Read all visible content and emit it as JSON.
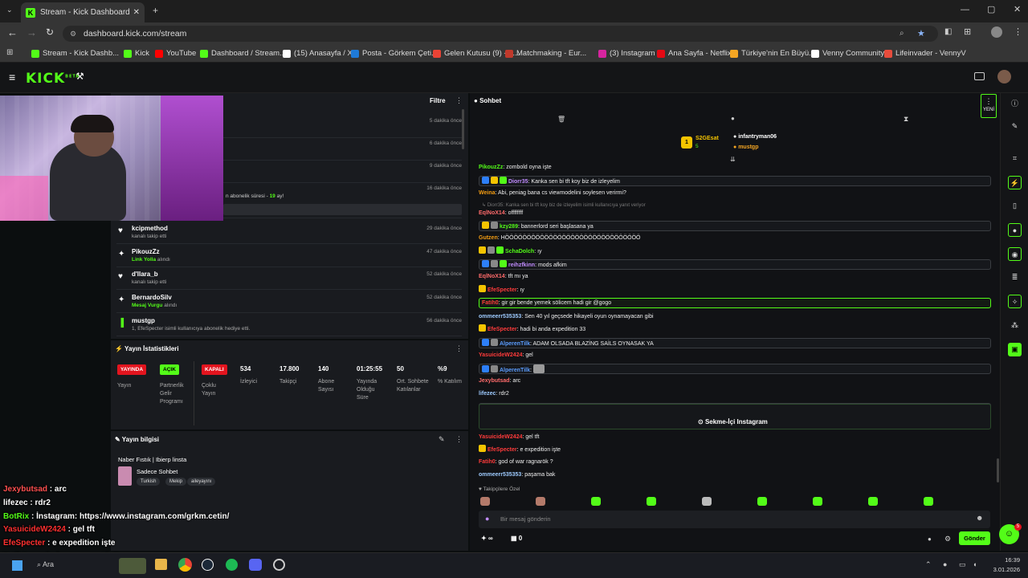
{
  "browser": {
    "tab_title": "Stream - Kick Dashboard",
    "url": "dashboard.kick.com/stream",
    "bookmarks": [
      {
        "label": "Stream - Kick Dashb...",
        "color": "#53fc18"
      },
      {
        "label": "Kick",
        "color": "#53fc18"
      },
      {
        "label": "YouTube",
        "color": "#ff0000"
      },
      {
        "label": "Dashboard / Stream...",
        "color": "#53fc18"
      },
      {
        "label": "(15) Anasayfa / X",
        "color": "#ffffff"
      },
      {
        "label": "Posta - Görkem Çeti...",
        "color": "#1e7ad8"
      },
      {
        "label": "Gelen Kutusu (9) - g...",
        "color": "#ea4335"
      },
      {
        "label": "Matchmaking - Eur...",
        "color": "#c0392b"
      },
      {
        "label": "(3) Instagram",
        "color": "#d6249f"
      },
      {
        "label": "Ana Sayfa - Netflix",
        "color": "#e50914"
      },
      {
        "label": "Türkiye'nin En Büyü...",
        "color": "#f5a623"
      },
      {
        "label": "Venny Community",
        "color": "#ffffff"
      },
      {
        "label": "Lifeinvader - VennyV",
        "color": "#e74c3c"
      }
    ]
  },
  "kick": {
    "logo": "KICK",
    "logo_tag": "BETA"
  },
  "activity": {
    "filter_label": "Filtre",
    "partial_times": [
      "5 dakika önce",
      "6 dakika önce",
      "9 dakika önce",
      "16 dakika önce"
    ],
    "partial_sub_text": "n abonelik süresi - ",
    "partial_sub_months": "19",
    "partial_sub_suffix": " ay!",
    "events": [
      {
        "name": "kcipmethod",
        "sub": "kanalı takip etti",
        "time": "29 dakika önce",
        "icon": "♥"
      },
      {
        "name": "PikouzZz",
        "sub_hl": "Link Yolla",
        "sub": " alındı",
        "time": "47 dakika önce",
        "icon": "✦"
      },
      {
        "name": "d'llara_b",
        "sub": "kanalı takip etti",
        "time": "52 dakika önce",
        "icon": "♥"
      },
      {
        "name": "BernardoSilv",
        "sub_hl": "Mesaj Vurgu",
        "sub": " alındı",
        "time": "52 dakika önce",
        "icon": "✦"
      },
      {
        "name": "mustgp",
        "sub": "1, EfeSpecter isimli kullanıcıya abonelik hediye etti.",
        "time": "56 dakika önce",
        "icon": "▐"
      }
    ]
  },
  "stats": {
    "title": "Yayın İstatistikleri",
    "status": {
      "badge": "YAYINDA",
      "label": "Yayın"
    },
    "partner": {
      "badge": "AÇIK",
      "label": "Partnerlik Gelir Programı"
    },
    "multi": {
      "badge": "KAPALI",
      "label": "Çoklu Yayın"
    },
    "metrics": [
      {
        "value": "534",
        "label": "İzleyici"
      },
      {
        "value": "17.800",
        "label": "Takipçi"
      },
      {
        "value": "140",
        "label": "Abone Sayısı"
      },
      {
        "value": "01:25:55",
        "label": "Yayında Olduğu Süre"
      },
      {
        "value": "50",
        "label": "Ort. Sohbete Katılanlar"
      },
      {
        "value": "%9",
        "label": "% Katılım"
      }
    ]
  },
  "info": {
    "title": "Yayın bilgisi",
    "stream_title": "Naber Fıstık | Ibierp linsta",
    "category": "Sadece Sohbet",
    "tags": [
      "Turkish",
      "Mekip",
      "aileyayını"
    ]
  },
  "chat": {
    "title": "Sohbet",
    "new_label": "YENİ",
    "top": {
      "user1": "S2GEsat",
      "user1_count": "5",
      "user2": "infantryman06",
      "user3": "mustgp"
    },
    "messages": [
      {
        "u": "PikouzZz",
        "c": "#53fc18",
        "t": "zombold oyna işte"
      },
      {
        "u": "Diorr35",
        "c": "#c18cff",
        "t": "Kanka sen bi tft koy biz de izleyelim",
        "hl": true,
        "icons": [
          "#2d7ff9",
          "#f5c400",
          "#53fc18"
        ]
      },
      {
        "u": "Weina",
        "c": "#f39c12",
        "t": "Abi, peniag bana cs viewmodelini soylesen verirmi?"
      },
      {
        "reply": "↳ Diorr35: Kanka sen bi tft koy biz de izleyelim isimli kullanıcıya yanıt veriyor"
      },
      {
        "u": "EqlNoX14",
        "c": "#ff6b6b",
        "t": "offffffff"
      },
      {
        "u": "kzy289",
        "c": "#53fc18",
        "t": "bannerlord seri başlasana ya",
        "hl": true,
        "icons": [
          "#f5c400",
          "#888"
        ]
      },
      {
        "u": "Gutzen",
        "c": "#f39c12",
        "t": "HÖÖÖÖÖÖÖÖÖÖÖÖÖÖÖÖÖÖÖÖÖÖÖÖÖÖÖÖÖÖÖ"
      },
      {
        "u": "SchaDolch",
        "c": "#53fc18",
        "t": "ıy",
        "icons": [
          "#f5c400",
          "#888",
          "#53fc18"
        ]
      },
      {
        "u": "reihzfkinn",
        "c": "#c18cff",
        "t": "mods afkim",
        "hl": true,
        "icons": [
          "#2d7ff9",
          "#888",
          "#53fc18"
        ]
      },
      {
        "u": "EqlNoX14",
        "c": "#ff6b6b",
        "t": "tft mı ya"
      },
      {
        "u": "EfeSpecter",
        "c": "#ff3b3b",
        "t": "ıy",
        "icons": [
          "#f5c400"
        ]
      },
      {
        "u": "Fatih0",
        "c": "#ff3b3b",
        "t": "gir gir bende yemek sölicem hadi gir @gogo",
        "green": true
      },
      {
        "u": "ommeerr535353",
        "c": "#9ecbff",
        "t": "Sen 40 yıl geçsede hikayeli oyun oynamayacan gibi"
      },
      {
        "u": "EfeSpecter",
        "c": "#ff3b3b",
        "t": "hadi bi anda expedition 33",
        "icons": [
          "#f5c400"
        ]
      },
      {
        "u": "AlperenTilk",
        "c": "#5b9dff",
        "t": "ADAM OLSADA BLAZİNG SAİLS OYNASAK YA",
        "hl": true,
        "icons": [
          "#2d7ff9",
          "#888"
        ]
      },
      {
        "u": "YasuicideW2424",
        "c": "#ff3b3b",
        "t": "gel"
      },
      {
        "u": "AlperenTilk",
        "c": "#5b9dff",
        "t": "",
        "hl": true,
        "icons": [
          "#2d7ff9",
          "#888"
        ],
        "emote": true
      },
      {
        "u": "Jexybutsad",
        "c": "#ff6b6b",
        "t": "arc"
      },
      {
        "u": "lifezec",
        "c": "#9ecbff",
        "t": "rdr2"
      },
      {
        "u": "BotRix",
        "c": "#53fc18",
        "t": "İnstagram: ",
        "link": "https://www.instagram.com/grkm.cetin/",
        "hl": true,
        "icons": [
          "#2d7ff9",
          "#53fc18"
        ]
      },
      {
        "u": "YasuicideW2424",
        "c": "#ff3b3b",
        "t": "gel tft"
      },
      {
        "u": "EfeSpecter",
        "c": "#ff3b3b",
        "t": "e expedition işte",
        "icons": [
          "#f5c400"
        ]
      },
      {
        "u": "Fatih0",
        "c": "#ff3b3b",
        "t": "god of war ragnarök ?"
      },
      {
        "u": "ommeerr535353",
        "c": "#9ecbff",
        "t": "paşama bak"
      }
    ],
    "insta_button": "Sekme-İçi Instagram",
    "special_label": "Takipçilere Özel",
    "input_placeholder": "Bir mesaj gönderin",
    "send_label": "Gönder",
    "points": "∞",
    "counter": "0"
  },
  "overlay": {
    "chat": [
      {
        "u": "Jexybutsad",
        "c": "#ff5050",
        "t": "arc"
      },
      {
        "u": "lifezec",
        "c": "#ffffff",
        "t": "rdr2"
      },
      {
        "u": "BotRix",
        "c": "#53fc18",
        "t": "İnstagram: https://www.instagram.com/grkm.cetin/"
      },
      {
        "u": "YasuicideW2424",
        "c": "#ff3030",
        "t": "gel tft"
      },
      {
        "u": "EfeSpecter",
        "c": "#ff3030",
        "t": "e expedition işte"
      },
      {
        "u": "Fatih0",
        "c": "#ff3030",
        "t": "god of war ragnarök ?"
      },
      {
        "u": "ommeerr535353",
        "c": "#cccccc",
        "t": "paşama bak"
      }
    ]
  },
  "taskbar": {
    "search": "Ara",
    "time": "16:39",
    "date": "3.01.2026",
    "notif": "5"
  }
}
